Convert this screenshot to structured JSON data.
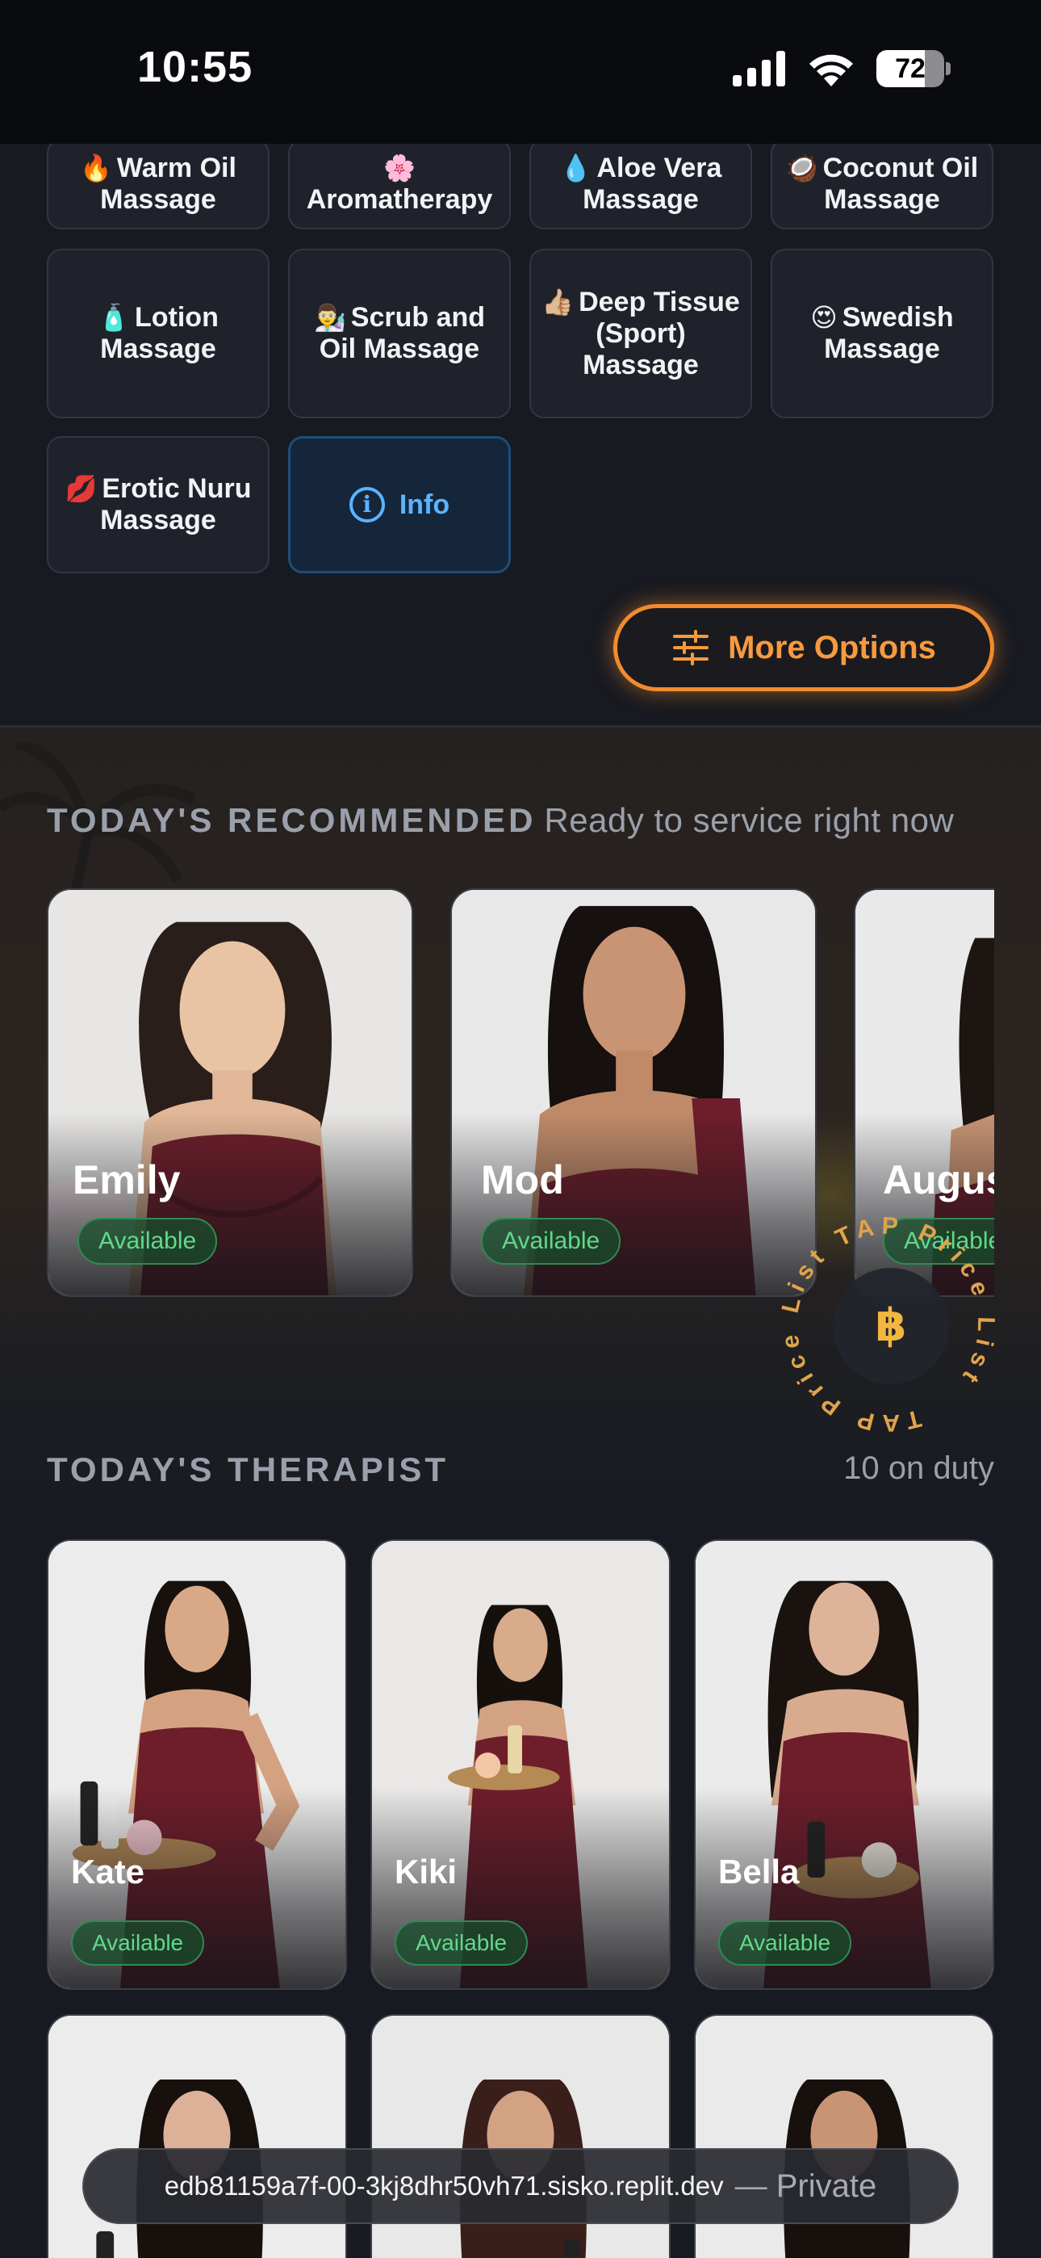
{
  "status_bar": {
    "time": "10:55",
    "battery": "72",
    "battery_level": 0.72
  },
  "services": [
    {
      "emoji": "🔥",
      "label": "Warm Oil Massage"
    },
    {
      "emoji": "🌸",
      "label": "Aromatherapy"
    },
    {
      "emoji": "💧",
      "label": "Aloe Vera Massage"
    },
    {
      "emoji": "🥥",
      "label": "Coconut Oil Massage"
    },
    {
      "emoji": "🧴",
      "label": "Lotion Massage"
    },
    {
      "emoji": "👨‍🔬",
      "label": "Scrub and Oil Massage"
    },
    {
      "emoji": "👍🏼",
      "label": "Deep Tissue (Sport) Massage"
    },
    {
      "emoji": "😍",
      "label": "Swedish Massage"
    },
    {
      "emoji": "💋",
      "label": "Erotic Nuru Massage"
    }
  ],
  "info_button": {
    "icon": "i",
    "label": "Info"
  },
  "more_options": {
    "label": "More Options"
  },
  "recommended": {
    "heading": "TODAY'S RECOMMENDED",
    "subheading": "Ready to service right now",
    "cards": [
      {
        "name": "Emily",
        "status": "Available"
      },
      {
        "name": "Mod",
        "status": "Available"
      },
      {
        "name": "August",
        "status": "Available"
      }
    ]
  },
  "price_badge": {
    "ring_text": "TAP Price List TAP Price List ",
    "symbol": "฿"
  },
  "therapists": {
    "heading": "TODAY'S THERAPIST",
    "count_label": "10 on duty",
    "cards": [
      {
        "name": "Kate",
        "status": "Available"
      },
      {
        "name": "Kiki",
        "status": "Available"
      },
      {
        "name": "Bella",
        "status": "Available"
      }
    ]
  },
  "url_bar": {
    "url": "edb81159a7f-00-3kj8dhr50vh71.sisko.replit.dev",
    "privacy": "— Private"
  },
  "colors": {
    "accent_orange": "#f38b2d",
    "info_blue": "#5ab4ff",
    "available_green": "#62d98a",
    "dress_burgundy": "#6e1d2b"
  }
}
